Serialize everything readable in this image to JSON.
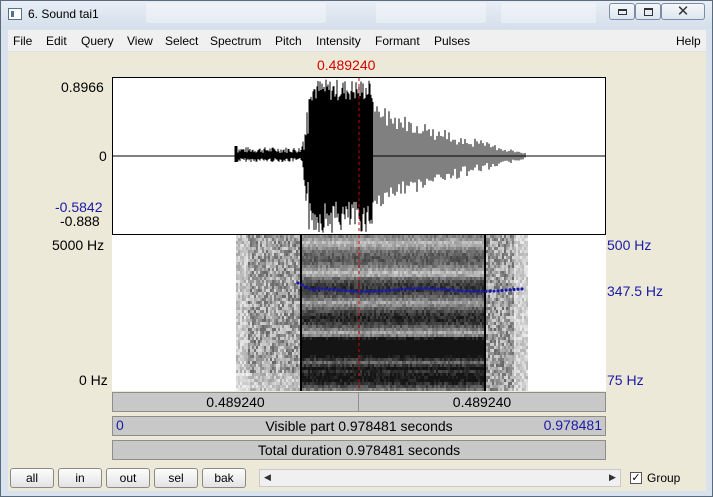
{
  "window": {
    "title": "6. Sound tai1"
  },
  "menu": {
    "items": [
      "File",
      "Edit",
      "Query",
      "View",
      "Select",
      "Spectrum",
      "Pitch",
      "Intensity",
      "Formant",
      "Pulses"
    ],
    "help": "Help"
  },
  "cursor": {
    "time_label": "0.489240",
    "time_fraction": 0.5
  },
  "waveform": {
    "y_max_label": "0.8966",
    "y_zero_label": "0",
    "y_min_label": "-0.888",
    "cursor_amplitude_label": "-0.5842"
  },
  "spectrogram": {
    "freq_top_label": "5000 Hz",
    "freq_bottom_label": "0 Hz",
    "pitch_top_label": "500 Hz",
    "pitch_value_label": "347.5 Hz",
    "pitch_bottom_label": "75 Hz"
  },
  "panels": {
    "left_time": "0.489240",
    "right_time": "0.489240",
    "visible_start": "0",
    "visible_label": "Visible part 0.978481 seconds",
    "visible_end": "0.978481",
    "total_label": "Total duration 0.978481 seconds"
  },
  "buttons": {
    "all": "all",
    "in": "in",
    "out": "out",
    "sel": "sel",
    "bak": "bak"
  },
  "group": {
    "label": "Group",
    "checked": true
  },
  "colors": {
    "cursor": "#d40000",
    "pitch": "#1a1aa8"
  }
}
